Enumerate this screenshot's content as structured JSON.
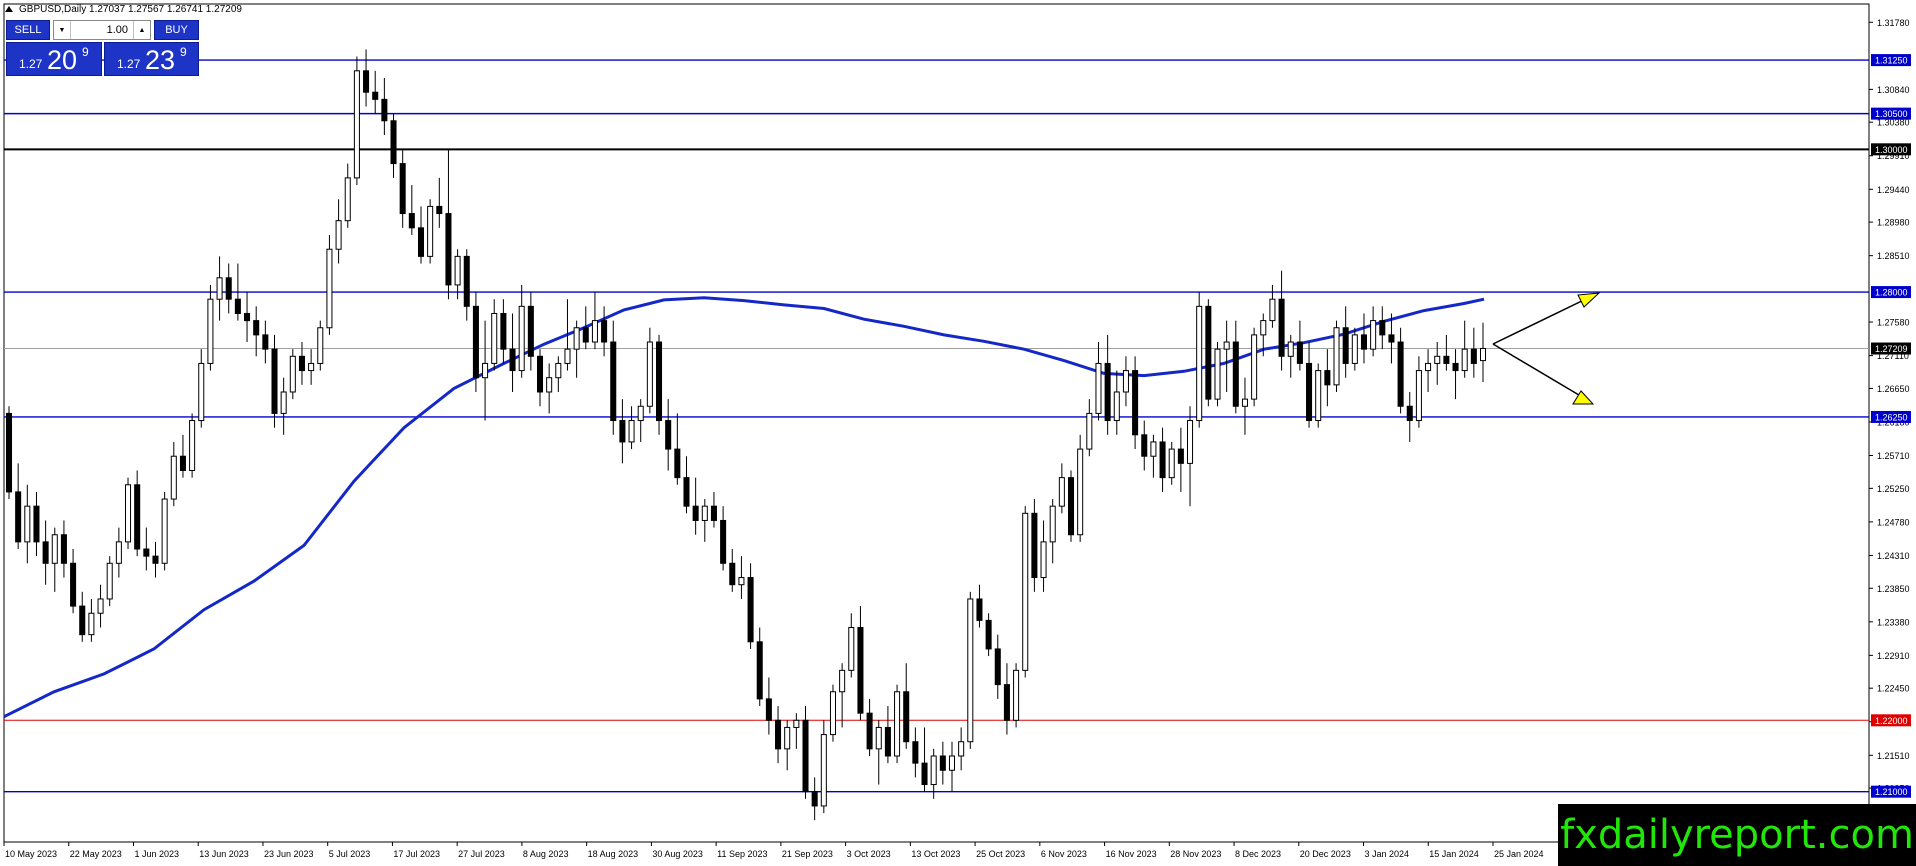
{
  "window": {
    "symbol_title": "GBPUSD,Daily  1.27037 1.27567 1.26741 1.27209"
  },
  "trade_panel": {
    "sell_label": "SELL",
    "buy_label": "BUY",
    "lot_value": "1.00",
    "sell_price_small": "1.27",
    "sell_price_big": "20",
    "sell_price_sup": "9",
    "buy_price_small": "1.27",
    "buy_price_big": "23",
    "buy_price_sup": "9",
    "lot_down_icon": "triangle-down-icon",
    "lot_up_icon": "triangle-up-icon"
  },
  "watermark": {
    "text": "fxdailyreport.com"
  },
  "colors": {
    "level_blue": "#0000cd",
    "level_black": "#000000",
    "level_red": "#e00000",
    "ma_line": "#1428c8",
    "arrow_fill": "#ffff00",
    "current_price_bg": "#000000",
    "level_label_bg": "#0000cd"
  },
  "chart_data": {
    "type": "candlestick",
    "symbol": "GBPUSD",
    "timeframe": "Daily",
    "title": "GBPUSD,Daily",
    "ylim": [
      1.20295,
      1.32036
    ],
    "price_ticks": [
      "1.31780",
      "1.30840",
      "1.30380",
      "1.29910",
      "1.29440",
      "1.28980",
      "1.28510",
      "1.27580",
      "1.27110",
      "1.26650",
      "1.26180",
      "1.25710",
      "1.25250",
      "1.24780",
      "1.24310",
      "1.23850",
      "1.23380",
      "1.22910",
      "1.22450",
      "1.21980",
      "1.21510",
      "1.21050",
      "1.20580"
    ],
    "date_labels": [
      "10 May 2023",
      "22 May 2023",
      "1 Jun 2023",
      "13 Jun 2023",
      "23 Jun 2023",
      "5 Jul 2023",
      "17 Jul 2023",
      "27 Jul 2023",
      "8 Aug 2023",
      "18 Aug 2023",
      "30 Aug 2023",
      "11 Sep 2023",
      "21 Sep 2023",
      "3 Oct 2023",
      "13 Oct 2023",
      "25 Oct 2023",
      "6 Nov 2023",
      "16 Nov 2023",
      "28 Nov 2023",
      "8 Dec 2023",
      "20 Dec 2023",
      "3 Jan 2024",
      "15 Jan 2024",
      "25 Jan 2024"
    ],
    "horizontal_levels": [
      {
        "price": 1.3125,
        "label": "1.31250",
        "style": "blue"
      },
      {
        "price": 1.305,
        "label": "1.30500",
        "style": "blue"
      },
      {
        "price": 1.3,
        "label": "1.30000",
        "style": "black"
      },
      {
        "price": 1.28,
        "label": "1.28000",
        "style": "blue"
      },
      {
        "price": 1.2625,
        "label": "1.26250",
        "style": "blue"
      },
      {
        "price": 1.22,
        "label": "1.22000",
        "style": "red"
      },
      {
        "price": 1.21,
        "label": "1.21000",
        "style": "blue"
      }
    ],
    "current_price": {
      "price": 1.27209,
      "label": "1.27209"
    },
    "candles": [
      [
        1.263,
        1.264,
        1.251,
        1.252
      ],
      [
        1.252,
        1.256,
        1.244,
        1.245
      ],
      [
        1.245,
        1.253,
        1.242,
        1.25
      ],
      [
        1.25,
        1.252,
        1.243,
        1.245
      ],
      [
        1.245,
        1.248,
        1.239,
        1.242
      ],
      [
        1.242,
        1.247,
        1.238,
        1.246
      ],
      [
        1.246,
        1.248,
        1.24,
        1.242
      ],
      [
        1.242,
        1.244,
        1.235,
        1.236
      ],
      [
        1.236,
        1.238,
        1.231,
        1.232
      ],
      [
        1.232,
        1.237,
        1.231,
        1.235
      ],
      [
        1.235,
        1.239,
        1.233,
        1.237
      ],
      [
        1.237,
        1.243,
        1.236,
        1.242
      ],
      [
        1.242,
        1.247,
        1.24,
        1.245
      ],
      [
        1.245,
        1.254,
        1.244,
        1.253
      ],
      [
        1.253,
        1.255,
        1.243,
        1.244
      ],
      [
        1.244,
        1.247,
        1.241,
        1.243
      ],
      [
        1.243,
        1.245,
        1.24,
        1.242
      ],
      [
        1.242,
        1.252,
        1.241,
        1.251
      ],
      [
        1.251,
        1.259,
        1.25,
        1.257
      ],
      [
        1.257,
        1.26,
        1.254,
        1.255
      ],
      [
        1.255,
        1.263,
        1.254,
        1.262
      ],
      [
        1.262,
        1.272,
        1.261,
        1.27
      ],
      [
        1.27,
        1.281,
        1.269,
        1.279
      ],
      [
        1.279,
        1.285,
        1.276,
        1.282
      ],
      [
        1.282,
        1.284,
        1.277,
        1.279
      ],
      [
        1.279,
        1.284,
        1.276,
        1.277
      ],
      [
        1.277,
        1.28,
        1.273,
        1.276
      ],
      [
        1.276,
        1.278,
        1.271,
        1.274
      ],
      [
        1.274,
        1.276,
        1.27,
        1.272
      ],
      [
        1.272,
        1.274,
        1.261,
        1.263
      ],
      [
        1.263,
        1.268,
        1.26,
        1.266
      ],
      [
        1.266,
        1.272,
        1.265,
        1.271
      ],
      [
        1.271,
        1.273,
        1.267,
        1.269
      ],
      [
        1.269,
        1.272,
        1.267,
        1.27
      ],
      [
        1.27,
        1.276,
        1.269,
        1.275
      ],
      [
        1.275,
        1.288,
        1.274,
        1.286
      ],
      [
        1.286,
        1.293,
        1.284,
        1.29
      ],
      [
        1.29,
        1.298,
        1.289,
        1.296
      ],
      [
        1.296,
        1.313,
        1.295,
        1.311
      ],
      [
        1.311,
        1.314,
        1.306,
        1.308
      ],
      [
        1.308,
        1.311,
        1.305,
        1.307
      ],
      [
        1.307,
        1.31,
        1.302,
        1.304
      ],
      [
        1.304,
        1.305,
        1.296,
        1.298
      ],
      [
        1.298,
        1.3,
        1.289,
        1.291
      ],
      [
        1.291,
        1.295,
        1.288,
        1.289
      ],
      [
        1.289,
        1.292,
        1.284,
        1.285
      ],
      [
        1.285,
        1.293,
        1.284,
        1.292
      ],
      [
        1.292,
        1.296,
        1.289,
        1.291
      ],
      [
        1.291,
        1.3,
        1.279,
        1.281
      ],
      [
        1.281,
        1.286,
        1.279,
        1.285
      ],
      [
        1.285,
        1.286,
        1.276,
        1.278
      ],
      [
        1.278,
        1.28,
        1.266,
        1.268
      ],
      [
        1.268,
        1.276,
        1.262,
        1.27
      ],
      [
        1.27,
        1.279,
        1.269,
        1.277
      ],
      [
        1.277,
        1.279,
        1.27,
        1.272
      ],
      [
        1.272,
        1.277,
        1.266,
        1.269
      ],
      [
        1.269,
        1.281,
        1.268,
        1.278
      ],
      [
        1.278,
        1.28,
        1.269,
        1.271
      ],
      [
        1.271,
        1.272,
        1.264,
        1.266
      ],
      [
        1.266,
        1.27,
        1.263,
        1.268
      ],
      [
        1.268,
        1.271,
        1.266,
        1.27
      ],
      [
        1.27,
        1.279,
        1.269,
        1.272
      ],
      [
        1.272,
        1.276,
        1.268,
        1.275
      ],
      [
        1.275,
        1.278,
        1.272,
        1.273
      ],
      [
        1.273,
        1.28,
        1.272,
        1.276
      ],
      [
        1.276,
        1.278,
        1.271,
        1.273
      ],
      [
        1.273,
        1.276,
        1.26,
        1.262
      ],
      [
        1.262,
        1.265,
        1.256,
        1.259
      ],
      [
        1.259,
        1.264,
        1.258,
        1.262
      ],
      [
        1.262,
        1.265,
        1.259,
        1.264
      ],
      [
        1.264,
        1.275,
        1.263,
        1.273
      ],
      [
        1.273,
        1.274,
        1.26,
        1.262
      ],
      [
        1.262,
        1.265,
        1.255,
        1.258
      ],
      [
        1.258,
        1.263,
        1.253,
        1.254
      ],
      [
        1.254,
        1.257,
        1.249,
        1.25
      ],
      [
        1.25,
        1.254,
        1.246,
        1.248
      ],
      [
        1.248,
        1.251,
        1.245,
        1.25
      ],
      [
        1.25,
        1.252,
        1.247,
        1.248
      ],
      [
        1.248,
        1.25,
        1.241,
        1.242
      ],
      [
        1.242,
        1.244,
        1.238,
        1.239
      ],
      [
        1.239,
        1.243,
        1.237,
        1.24
      ],
      [
        1.24,
        1.242,
        1.23,
        1.231
      ],
      [
        1.231,
        1.233,
        1.222,
        1.223
      ],
      [
        1.223,
        1.226,
        1.218,
        1.22
      ],
      [
        1.22,
        1.222,
        1.214,
        1.216
      ],
      [
        1.216,
        1.22,
        1.213,
        1.219
      ],
      [
        1.219,
        1.221,
        1.216,
        1.22
      ],
      [
        1.22,
        1.222,
        1.209,
        1.21
      ],
      [
        1.21,
        1.212,
        1.206,
        1.208
      ],
      [
        1.208,
        1.22,
        1.207,
        1.218
      ],
      [
        1.218,
        1.225,
        1.217,
        1.224
      ],
      [
        1.224,
        1.228,
        1.219,
        1.227
      ],
      [
        1.227,
        1.235,
        1.226,
        1.233
      ],
      [
        1.233,
        1.236,
        1.22,
        1.221
      ],
      [
        1.221,
        1.223,
        1.215,
        1.216
      ],
      [
        1.216,
        1.22,
        1.211,
        1.219
      ],
      [
        1.219,
        1.222,
        1.214,
        1.215
      ],
      [
        1.215,
        1.225,
        1.214,
        1.224
      ],
      [
        1.224,
        1.228,
        1.216,
        1.217
      ],
      [
        1.217,
        1.219,
        1.212,
        1.214
      ],
      [
        1.214,
        1.219,
        1.21,
        1.211
      ],
      [
        1.211,
        1.216,
        1.209,
        1.215
      ],
      [
        1.215,
        1.217,
        1.211,
        1.213
      ],
      [
        1.213,
        1.217,
        1.21,
        1.215
      ],
      [
        1.215,
        1.219,
        1.213,
        1.217
      ],
      [
        1.217,
        1.238,
        1.216,
        1.237
      ],
      [
        1.237,
        1.239,
        1.233,
        1.234
      ],
      [
        1.234,
        1.235,
        1.229,
        1.23
      ],
      [
        1.23,
        1.232,
        1.223,
        1.225
      ],
      [
        1.225,
        1.228,
        1.218,
        1.22
      ],
      [
        1.22,
        1.228,
        1.219,
        1.227
      ],
      [
        1.227,
        1.25,
        1.226,
        1.249
      ],
      [
        1.249,
        1.251,
        1.238,
        1.24
      ],
      [
        1.24,
        1.248,
        1.238,
        1.245
      ],
      [
        1.245,
        1.251,
        1.242,
        1.25
      ],
      [
        1.25,
        1.256,
        1.249,
        1.254
      ],
      [
        1.254,
        1.255,
        1.245,
        1.246
      ],
      [
        1.246,
        1.26,
        1.245,
        1.258
      ],
      [
        1.258,
        1.265,
        1.257,
        1.263
      ],
      [
        1.263,
        1.273,
        1.262,
        1.27
      ],
      [
        1.27,
        1.274,
        1.26,
        1.262
      ],
      [
        1.262,
        1.269,
        1.26,
        1.266
      ],
      [
        1.266,
        1.271,
        1.264,
        1.269
      ],
      [
        1.269,
        1.271,
        1.258,
        1.26
      ],
      [
        1.26,
        1.262,
        1.255,
        1.257
      ],
      [
        1.257,
        1.26,
        1.254,
        1.259
      ],
      [
        1.259,
        1.261,
        1.252,
        1.254
      ],
      [
        1.254,
        1.259,
        1.253,
        1.258
      ],
      [
        1.258,
        1.261,
        1.252,
        1.256
      ],
      [
        1.256,
        1.264,
        1.25,
        1.262
      ],
      [
        1.262,
        1.28,
        1.261,
        1.278
      ],
      [
        1.278,
        1.279,
        1.264,
        1.265
      ],
      [
        1.265,
        1.273,
        1.264,
        1.272
      ],
      [
        1.272,
        1.276,
        1.266,
        1.273
      ],
      [
        1.273,
        1.276,
        1.263,
        1.264
      ],
      [
        1.264,
        1.268,
        1.26,
        1.265
      ],
      [
        1.265,
        1.275,
        1.264,
        1.274
      ],
      [
        1.274,
        1.277,
        1.271,
        1.276
      ],
      [
        1.276,
        1.281,
        1.275,
        1.279
      ],
      [
        1.279,
        1.283,
        1.269,
        1.271
      ],
      [
        1.271,
        1.274,
        1.268,
        1.273
      ],
      [
        1.273,
        1.276,
        1.269,
        1.27
      ],
      [
        1.27,
        1.273,
        1.261,
        1.262
      ],
      [
        1.262,
        1.27,
        1.261,
        1.269
      ],
      [
        1.269,
        1.272,
        1.264,
        1.267
      ],
      [
        1.267,
        1.276,
        1.266,
        1.275
      ],
      [
        1.275,
        1.278,
        1.268,
        1.27
      ],
      [
        1.27,
        1.275,
        1.269,
        1.274
      ],
      [
        1.274,
        1.277,
        1.27,
        1.272
      ],
      [
        1.272,
        1.278,
        1.271,
        1.276
      ],
      [
        1.276,
        1.278,
        1.272,
        1.274
      ],
      [
        1.274,
        1.277,
        1.27,
        1.273
      ],
      [
        1.273,
        1.275,
        1.263,
        1.264
      ],
      [
        1.264,
        1.266,
        1.259,
        1.262
      ],
      [
        1.262,
        1.271,
        1.261,
        1.269
      ],
      [
        1.269,
        1.272,
        1.266,
        1.27
      ],
      [
        1.27,
        1.273,
        1.267,
        1.271
      ],
      [
        1.271,
        1.274,
        1.269,
        1.27
      ],
      [
        1.27,
        1.272,
        1.265,
        1.269
      ],
      [
        1.269,
        1.276,
        1.268,
        1.272
      ],
      [
        1.272,
        1.275,
        1.268,
        1.27
      ],
      [
        1.2704,
        1.2757,
        1.2674,
        1.2721
      ]
    ],
    "moving_average": [
      [
        0,
        1.2205
      ],
      [
        50,
        1.224
      ],
      [
        100,
        1.2265
      ],
      [
        150,
        1.23
      ],
      [
        200,
        1.2355
      ],
      [
        250,
        1.2395
      ],
      [
        300,
        1.2445
      ],
      [
        350,
        1.2535
      ],
      [
        400,
        1.261
      ],
      [
        450,
        1.2665
      ],
      [
        500,
        1.27
      ],
      [
        540,
        1.2727
      ],
      [
        580,
        1.275
      ],
      [
        620,
        1.2775
      ],
      [
        660,
        1.2789
      ],
      [
        700,
        1.2792
      ],
      [
        740,
        1.2788
      ],
      [
        780,
        1.2782
      ],
      [
        820,
        1.2777
      ],
      [
        860,
        1.2762
      ],
      [
        900,
        1.2752
      ],
      [
        940,
        1.274
      ],
      [
        980,
        1.2731
      ],
      [
        1020,
        1.272
      ],
      [
        1060,
        1.2704
      ],
      [
        1100,
        1.2686
      ],
      [
        1140,
        1.2683
      ],
      [
        1180,
        1.2689
      ],
      [
        1220,
        1.27
      ],
      [
        1260,
        1.272
      ],
      [
        1300,
        1.2729
      ],
      [
        1340,
        1.2741
      ],
      [
        1380,
        1.2759
      ],
      [
        1420,
        1.2774
      ],
      [
        1460,
        1.2784
      ],
      [
        1480,
        1.279
      ]
    ]
  }
}
